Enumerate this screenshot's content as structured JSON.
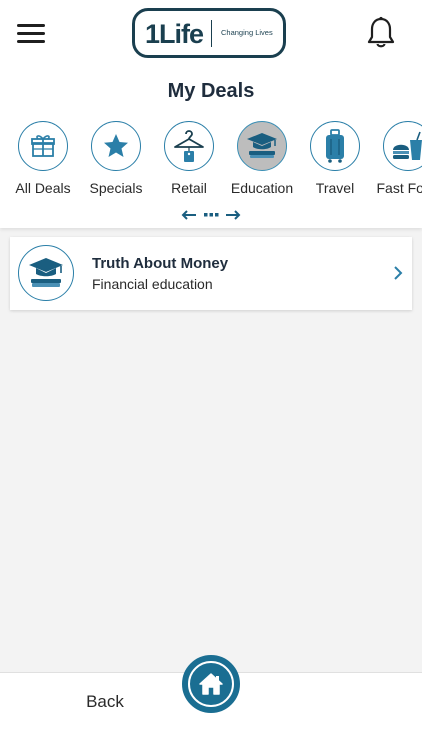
{
  "header": {
    "logo_mark": "1Life",
    "logo_tagline": "Changing Lives",
    "menu_icon": "hamburger-menu-icon",
    "notification_icon": "bell-icon"
  },
  "page": {
    "title": "My Deals"
  },
  "categories": [
    {
      "label": "All Deals",
      "icon": "gift-icon",
      "active": false
    },
    {
      "label": "Specials",
      "icon": "star-icon",
      "active": false
    },
    {
      "label": "Retail",
      "icon": "hanger-icon",
      "active": false
    },
    {
      "label": "Education",
      "icon": "graduation-cap-icon",
      "active": true
    },
    {
      "label": "Travel",
      "icon": "suitcase-icon",
      "active": false
    },
    {
      "label": "Fast Food",
      "icon": "fast-food-icon",
      "active": false
    }
  ],
  "deals": [
    {
      "title": "Truth About Money",
      "subtitle": "Financial education",
      "icon": "graduation-cap-icon"
    }
  ],
  "footer": {
    "back_label": "Back",
    "home_icon": "home-icon"
  },
  "colors": {
    "accent": "#2b7fa8",
    "brand_dark": "#1a3f4f",
    "home_button": "#1a6e92",
    "active_category": "#bdbdbd"
  }
}
